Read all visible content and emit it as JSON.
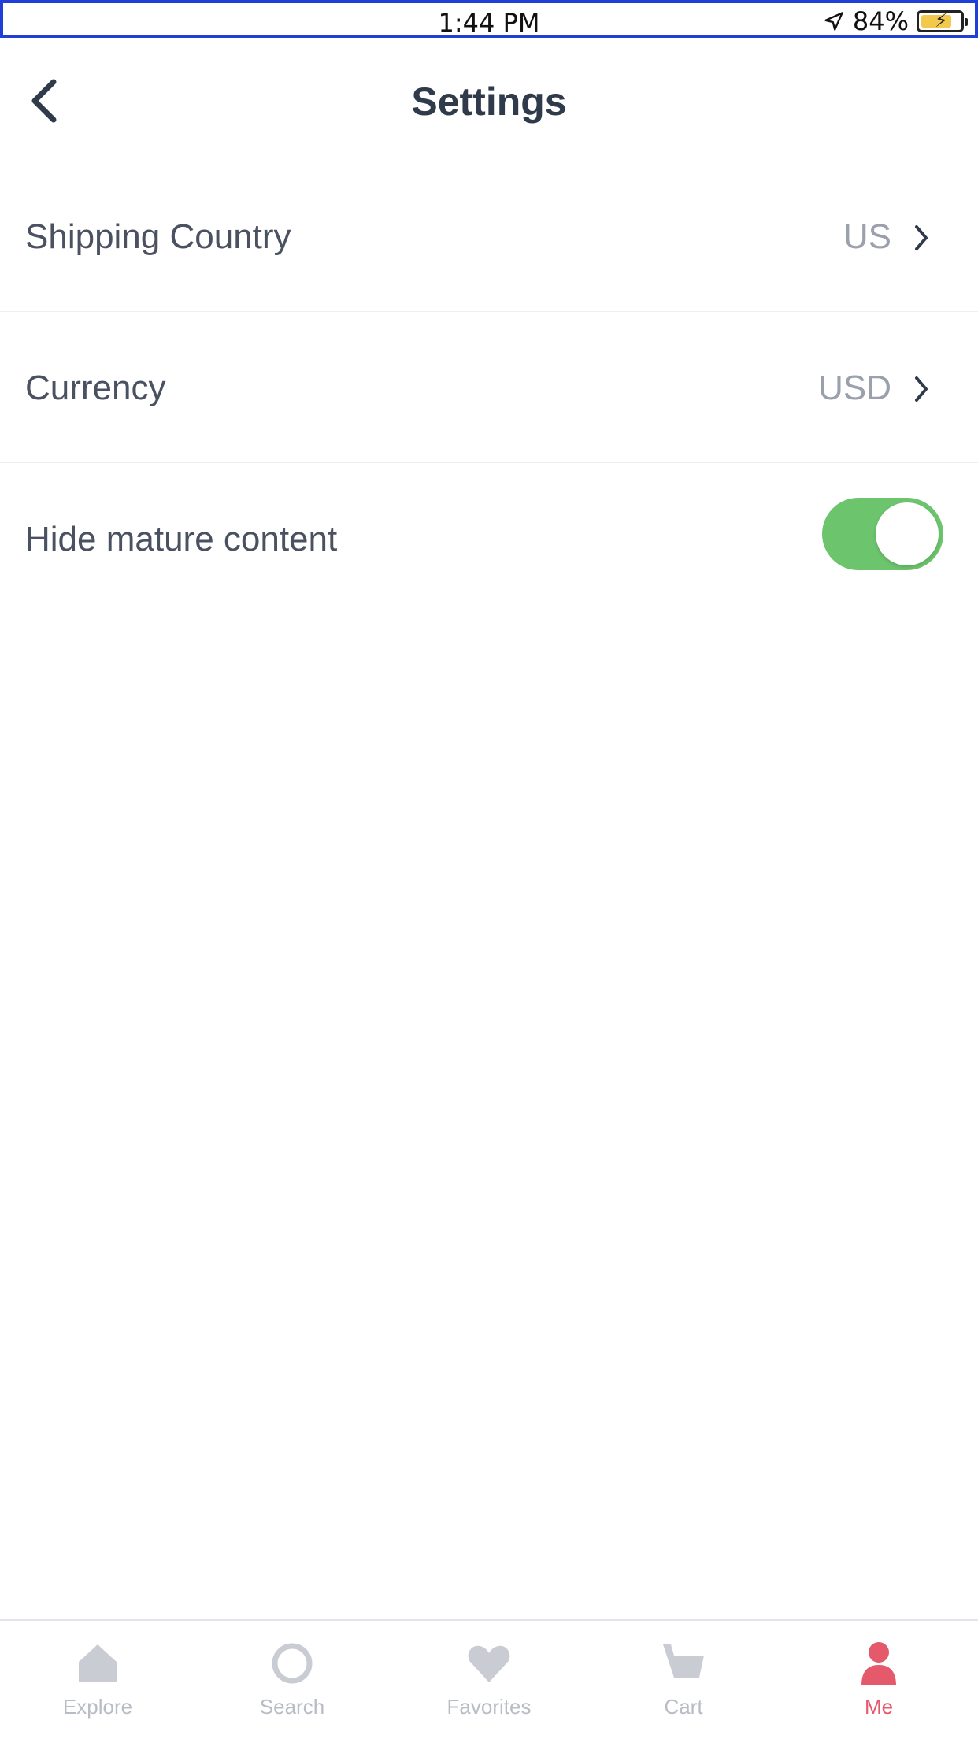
{
  "status_bar": {
    "time": "1:44 PM",
    "battery": "84%"
  },
  "header": {
    "title": "Settings"
  },
  "settings": {
    "rows": [
      {
        "label": "Shipping Country",
        "value": "US"
      },
      {
        "label": "Currency",
        "value": "USD"
      },
      {
        "label": "Hide mature content",
        "toggle_on": true
      }
    ]
  },
  "tabbar": {
    "items": [
      {
        "label": "Explore",
        "icon": "home-icon"
      },
      {
        "label": "Search",
        "icon": "search-icon"
      },
      {
        "label": "Favorites",
        "icon": "heart-icon"
      },
      {
        "label": "Cart",
        "icon": "cart-icon"
      },
      {
        "label": "Me",
        "icon": "user-icon"
      }
    ],
    "active_index": 4
  },
  "colors": {
    "switch_on": "#6cc46c",
    "tab_active": "#e55a6b",
    "tab_inactive": "#c9ccd3",
    "text": "#2f3a4a",
    "value_text": "#9aa1ad"
  }
}
